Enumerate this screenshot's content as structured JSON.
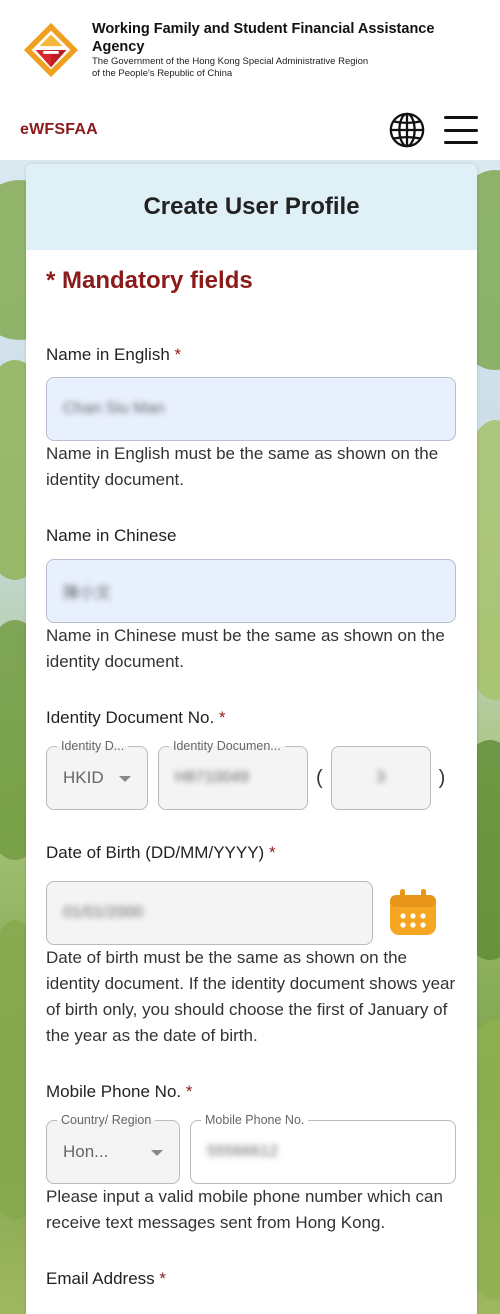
{
  "header": {
    "agency_name": "Working Family and Student Financial Assistance Agency",
    "gov_line1": "The Government of the Hong Kong Special Administrative Region",
    "gov_line2": "of the People's Republic of China",
    "brand": "eWFSFAA",
    "icons": [
      "logo-icon",
      "globe-icon",
      "menu-icon"
    ]
  },
  "card": {
    "title": "Create User Profile",
    "mandatory_note": "* Mandatory fields"
  },
  "fields": {
    "name_en": {
      "label": "Name in English ",
      "required": "*",
      "value": "Chan Siu Man",
      "help": "Name in English must be the same as shown on the identity document."
    },
    "name_zh": {
      "label": "Name in Chinese",
      "value": "陳小文",
      "help": "Name in Chinese must be the same as shown on the identity document."
    },
    "id_doc": {
      "label": "Identity Document No. ",
      "required": "*",
      "type_legend": "Identity D...",
      "type_value": "HKID",
      "number_legend": "Identity Documen...",
      "number_value": "H8710049",
      "check_digit": "3",
      "open_paren": "(",
      "close_paren": ")"
    },
    "dob": {
      "label": "Date of Birth (DD/MM/YYYY) ",
      "required": "*",
      "value": "01/01/2000",
      "help": "Date of birth must be the same as shown on the identity document. If the identity document shows year of birth only, you should choose the first of January of the year as the date of birth."
    },
    "mobile": {
      "label": "Mobile Phone No. ",
      "required": "*",
      "region_legend": "Country/ Region",
      "region_value": "Hon...",
      "phone_legend": "Mobile Phone No.",
      "phone_value": "55566612",
      "help": "Please input a valid mobile phone number which can receive text messages sent from Hong Kong."
    },
    "email": {
      "label": "Email Address ",
      "required": "*"
    }
  },
  "colors": {
    "brand_red": "#8b1a1a",
    "header_bg": "#dff0f6",
    "autofill_bg": "#e8f0fe",
    "calendar_orange": "#f5a623"
  }
}
